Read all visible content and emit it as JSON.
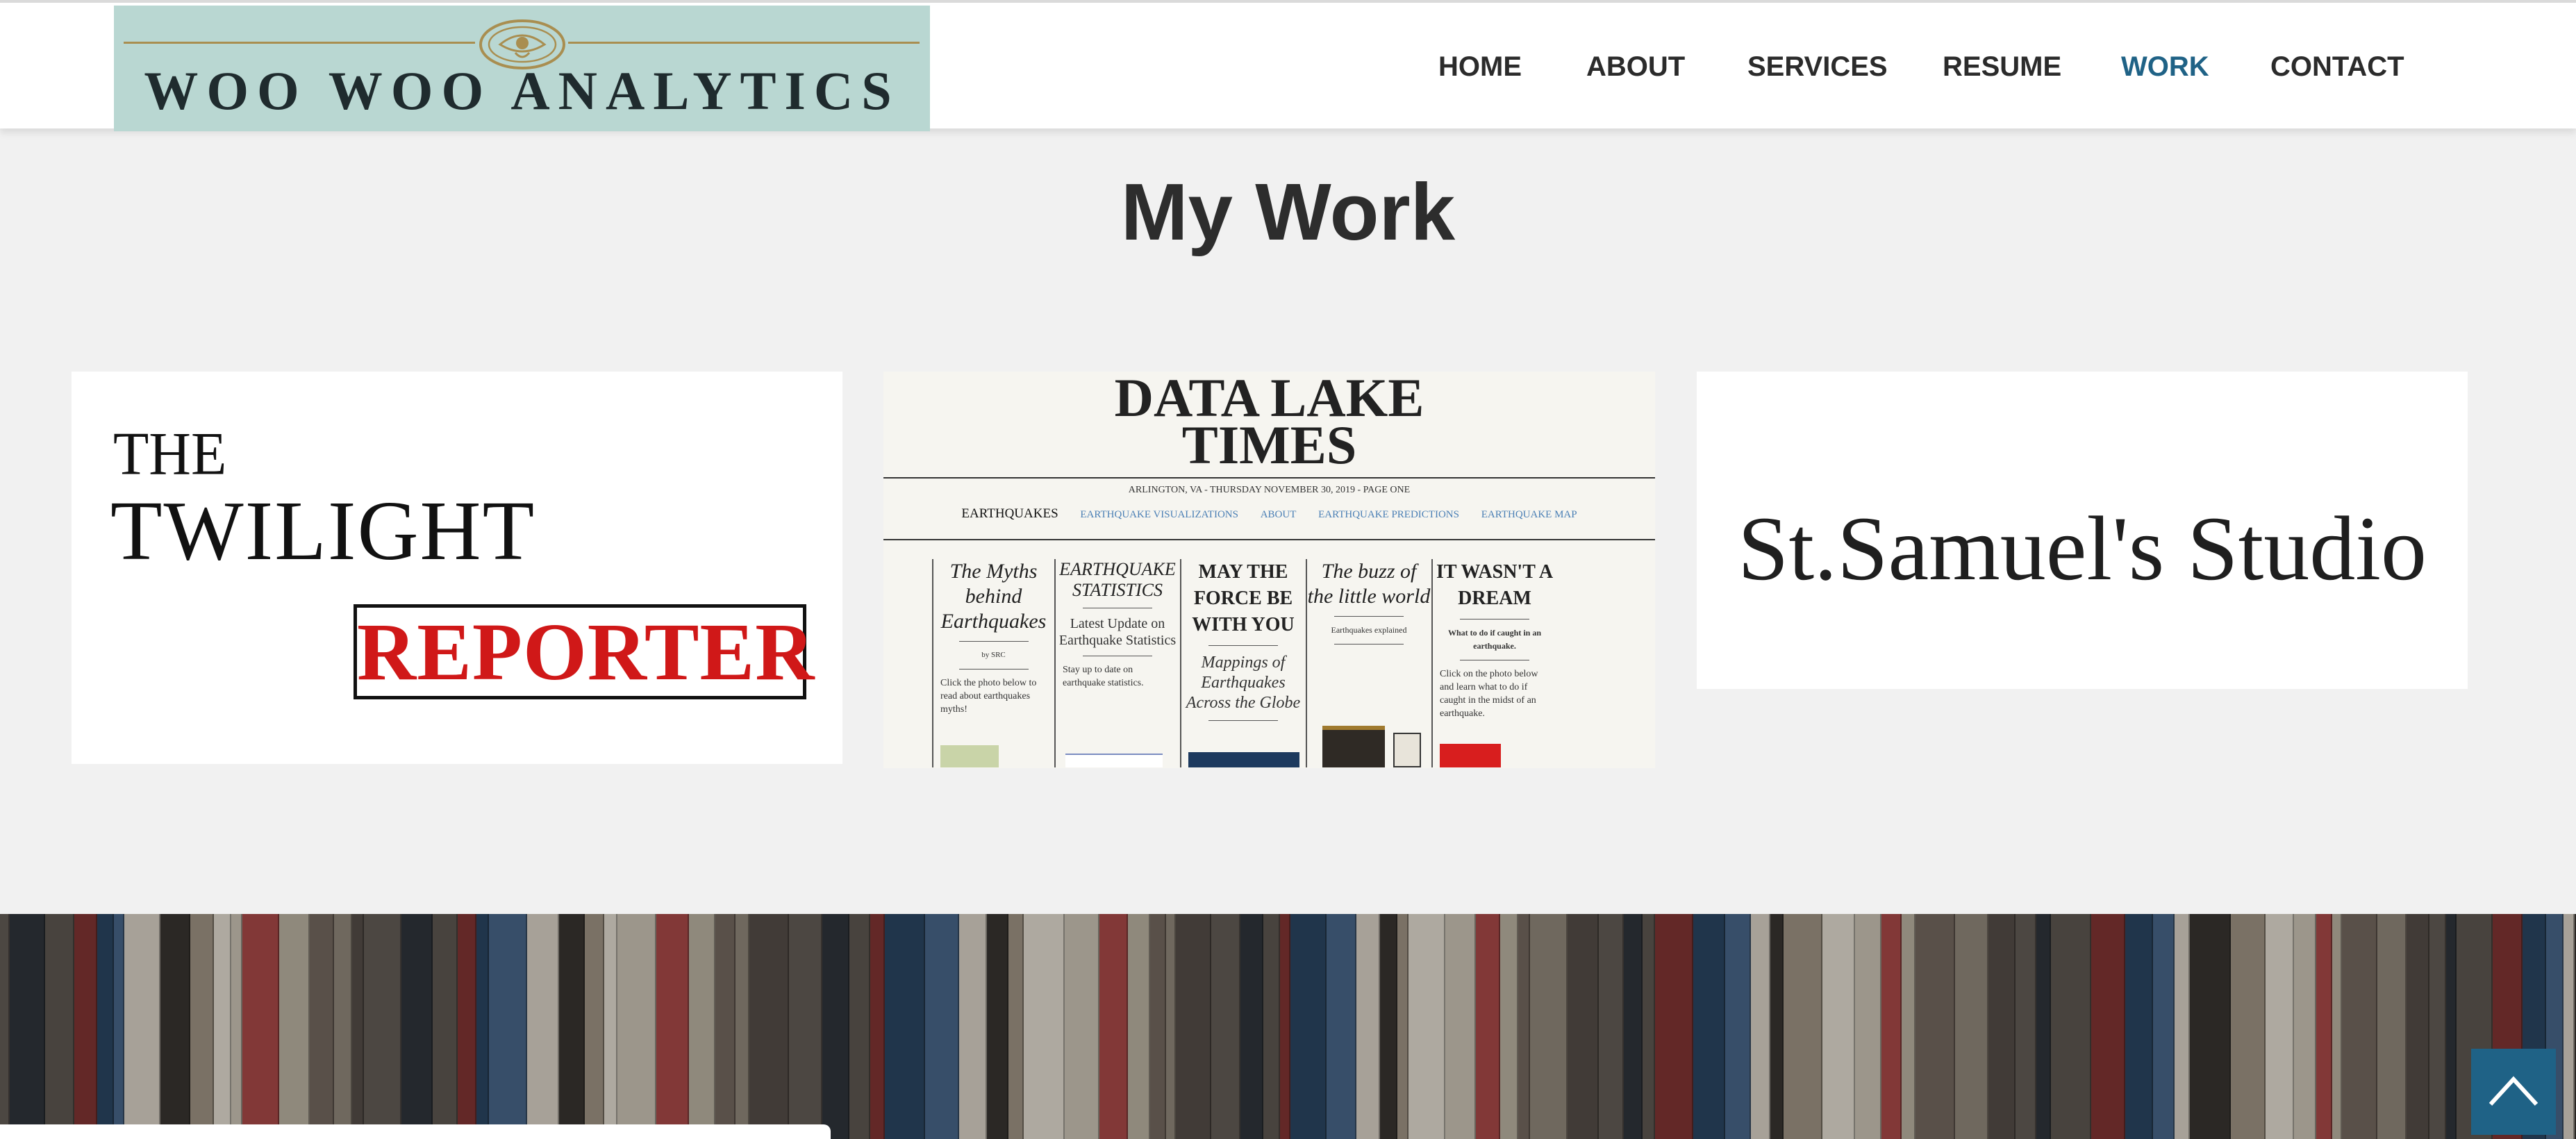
{
  "header": {
    "logo_text": "Woo Woo Analytics",
    "nav": [
      {
        "label": "HOME",
        "active": false
      },
      {
        "label": "ABOUT",
        "active": false
      },
      {
        "label": "SERVICES",
        "active": false
      },
      {
        "label": "RESUME",
        "active": false
      },
      {
        "label": "WORK",
        "active": true
      },
      {
        "label": "CONTACT",
        "active": false
      }
    ]
  },
  "main": {
    "title": "My Work",
    "cards": {
      "twilight": {
        "the": "THE",
        "twilight": "TWILIGHT",
        "reporter": "REPORTER"
      },
      "data_lake": {
        "title_line1": "DATA LAKE",
        "title_line2": "TIMES",
        "dateline": "ARLINGTON, VA - THURSDAY NOVEMBER 30, 2019 - PAGE ONE",
        "nav": [
          "EARTHQUAKES",
          "EARTHQUAKE VISUALIZATIONS",
          "ABOUT",
          "EARTHQUAKE PREDICTIONS",
          "EARTHQUAKE MAP"
        ],
        "columns": [
          {
            "heading": "The Myths behind Earthquakes",
            "byline": "by SRC",
            "body": "Click the photo below to read about earthquakes myths!"
          },
          {
            "heading": "EARTHQUAKE STATISTICS",
            "sub": "Latest Update on Earthquake Statistics",
            "body": "Stay up to date on earthquake statistics."
          },
          {
            "heading": "MAY THE FORCE BE WITH YOU",
            "sub": "Mappings of Earthquakes Across the Globe"
          },
          {
            "heading": "The buzz of the little world",
            "byline": "Earthquakes explained"
          },
          {
            "heading": "IT WASN'T A DREAM",
            "byline": "What to do if caught in an earthquake.",
            "body": "Click on the photo below and learn what to do if caught in the midst of an earthquake."
          }
        ]
      },
      "studio": {
        "title": "St.Samuel's Studio"
      }
    }
  },
  "colors": {
    "accent": "#1f6286",
    "logo_bg": "#b9d7d2",
    "page_bg": "#f1f1f1",
    "reporter_red": "#d01818"
  },
  "icons": {
    "back_to_top": "chevron-up-icon"
  }
}
